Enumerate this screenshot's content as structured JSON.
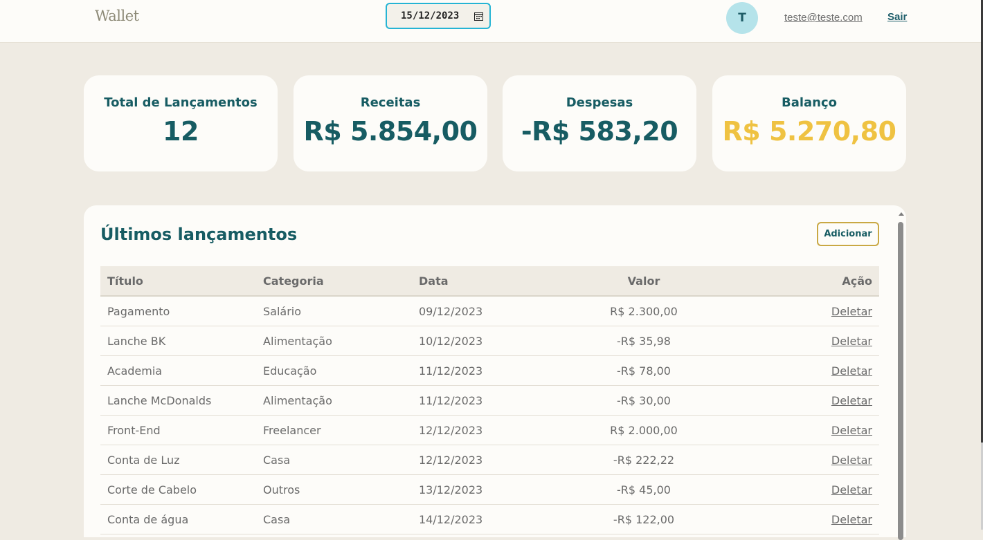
{
  "header": {
    "logo": "Wallet",
    "date_value": "15/12/2023",
    "avatar_initial": "T",
    "email": "teste@teste.com",
    "logout": "Sair"
  },
  "summary": [
    {
      "label": "Total de Lançamentos",
      "value": "12"
    },
    {
      "label": "Receitas",
      "value": "R$ 5.854,00"
    },
    {
      "label": "Despesas",
      "value": "-R$ 583,20"
    },
    {
      "label": "Balanço",
      "value": "R$ 5.270,80"
    }
  ],
  "colors": {
    "accent": "#175c63",
    "balance": "#efc242",
    "background": "#efebe3"
  },
  "transactions": {
    "title": "Últimos lançamentos",
    "add_label": "Adicionar",
    "headers": [
      "Título",
      "Categoria",
      "Data",
      "Valor",
      "Ação"
    ],
    "rows": [
      {
        "titulo": "Pagamento",
        "categoria": "Salário",
        "data": "09/12/2023",
        "valor": "R$ 2.300,00",
        "acao": "Deletar"
      },
      {
        "titulo": "Lanche BK",
        "categoria": "Alimentação",
        "data": "10/12/2023",
        "valor": "-R$ 35,98",
        "acao": "Deletar"
      },
      {
        "titulo": "Academia",
        "categoria": "Educação",
        "data": "11/12/2023",
        "valor": "-R$ 78,00",
        "acao": "Deletar"
      },
      {
        "titulo": "Lanche McDonalds",
        "categoria": "Alimentação",
        "data": "11/12/2023",
        "valor": "-R$ 30,00",
        "acao": "Deletar"
      },
      {
        "titulo": "Front-End",
        "categoria": "Freelancer",
        "data": "12/12/2023",
        "valor": "R$ 2.000,00",
        "acao": "Deletar"
      },
      {
        "titulo": "Conta de Luz",
        "categoria": "Casa",
        "data": "12/12/2023",
        "valor": "-R$ 222,22",
        "acao": "Deletar"
      },
      {
        "titulo": "Corte de Cabelo",
        "categoria": "Outros",
        "data": "13/12/2023",
        "valor": "-R$ 45,00",
        "acao": "Deletar"
      },
      {
        "titulo": "Conta de água",
        "categoria": "Casa",
        "data": "14/12/2023",
        "valor": "-R$ 122,00",
        "acao": "Deletar"
      }
    ]
  }
}
